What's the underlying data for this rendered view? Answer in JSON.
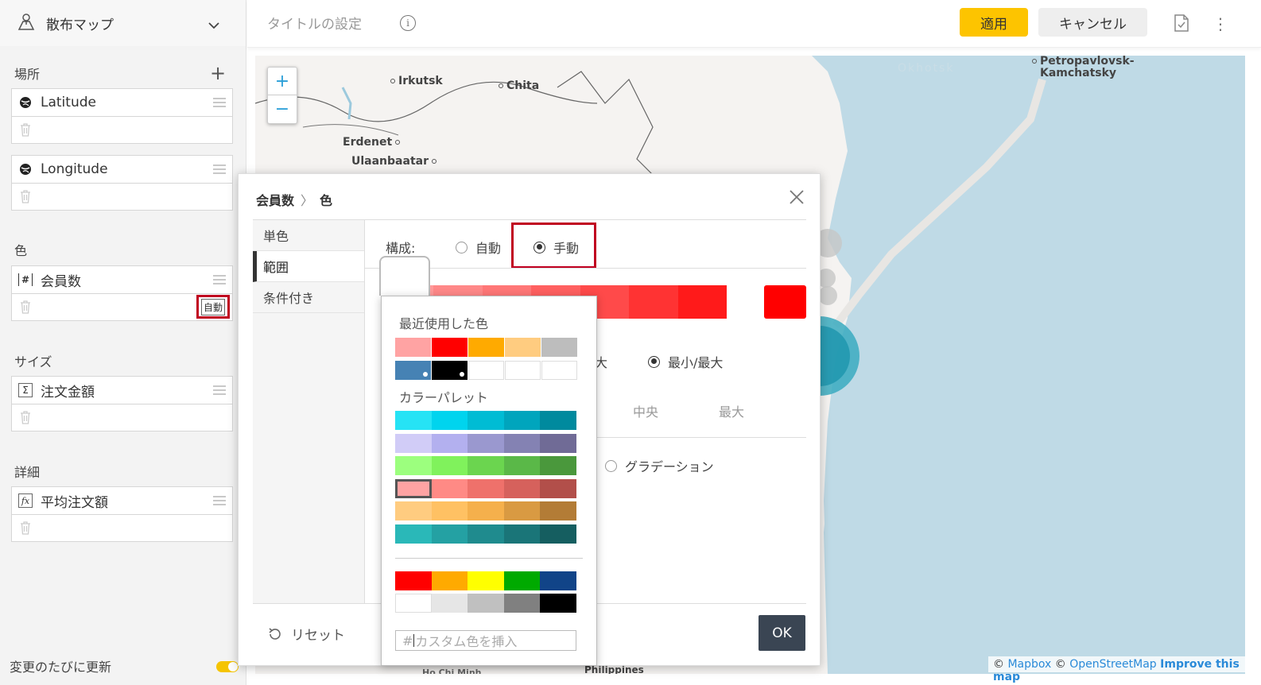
{
  "sidebar": {
    "viz_type": "散布マップ",
    "sections": {
      "location": {
        "title": "場所",
        "fields": [
          "Latitude",
          "Longitude"
        ]
      },
      "color": {
        "title": "色",
        "field": "会員数",
        "badge": "自動"
      },
      "size": {
        "title": "サイズ",
        "field": "注文金額"
      },
      "detail": {
        "title": "詳細",
        "field": "平均注文額"
      }
    },
    "update_label": "変更のたびに更新"
  },
  "topbar": {
    "title_placeholder": "タイトルの設定",
    "apply_label": "適用",
    "cancel_label": "キャンセル"
  },
  "map": {
    "cities": [
      "Irkutsk",
      "Chita",
      "Erdenet",
      "Ulaanbaatar",
      "Petropavlovsk-",
      "Kamchatsky",
      "Okhotsk",
      "Philippines",
      "Ho Chi Minh"
    ],
    "attribution": {
      "c1": "©",
      "mapbox": "Mapbox",
      "c2": "©",
      "osm": "OpenStreetMap",
      "improve": "Improve this map"
    },
    "zoom_in": "+",
    "zoom_out": "−"
  },
  "dialog": {
    "crumb_field": "会員数",
    "crumb_sep": "〉",
    "crumb_item": "色",
    "tabs": [
      "単色",
      "範囲",
      "条件付き"
    ],
    "active_tab": "範囲",
    "composition_label": "構成:",
    "radio_auto": "自動",
    "radio_manual": "手動",
    "minmax_partial": "大",
    "minmax_label": "最小/最大",
    "stop_mid": "中央",
    "stop_max": "最大",
    "gradation_label": "グラデーション",
    "reset_label": "リセット",
    "ok_label": "OK",
    "gradient_colors": [
      "#ff9999",
      "#ff8888",
      "#ff7777",
      "#ff6060",
      "#ff4a4a",
      "#ff3333",
      "#ff1a1a"
    ],
    "end_color": "#ff0000"
  },
  "picker": {
    "recent_title": "最近使用した色",
    "palette_title": "カラーパレット",
    "recent": [
      [
        "#ffa3a3",
        "#ff0000",
        "#ffaa00",
        "#ffcc80",
        "#bdbdbd"
      ],
      [
        "#4682b4",
        "#000000",
        "#ffffff",
        "#ffffff",
        "#ffffff"
      ]
    ],
    "palette": [
      [
        "#26e3f5",
        "#00d4ee",
        "#00bcd4",
        "#00a5bd",
        "#008a9e"
      ],
      [
        "#d1ccf7",
        "#b3b0ef",
        "#9a98cf",
        "#8482b3",
        "#706b96"
      ],
      [
        "#9cff7e",
        "#80f25c",
        "#6bd54f",
        "#5ab848",
        "#4a983c"
      ],
      [
        "#ffa3a3",
        "#ff8a85",
        "#ef716b",
        "#d6615c",
        "#b24f4a"
      ],
      [
        "#ffcc80",
        "#ffc163",
        "#f5b04c",
        "#d99a42",
        "#b37c36"
      ],
      [
        "#2ab8b8",
        "#24a1a3",
        "#1f8b8e",
        "#1a7578",
        "#155e60"
      ]
    ],
    "standard": [
      [
        "#ff0000",
        "#ffaa00",
        "#ffff00",
        "#00aa00",
        "#114488"
      ],
      [
        "#ffffff",
        "#e6e6e6",
        "#c0c0c0",
        "#808080",
        "#000000"
      ]
    ],
    "custom_hash": "#",
    "custom_placeholder": "カスタム色を挿入"
  }
}
